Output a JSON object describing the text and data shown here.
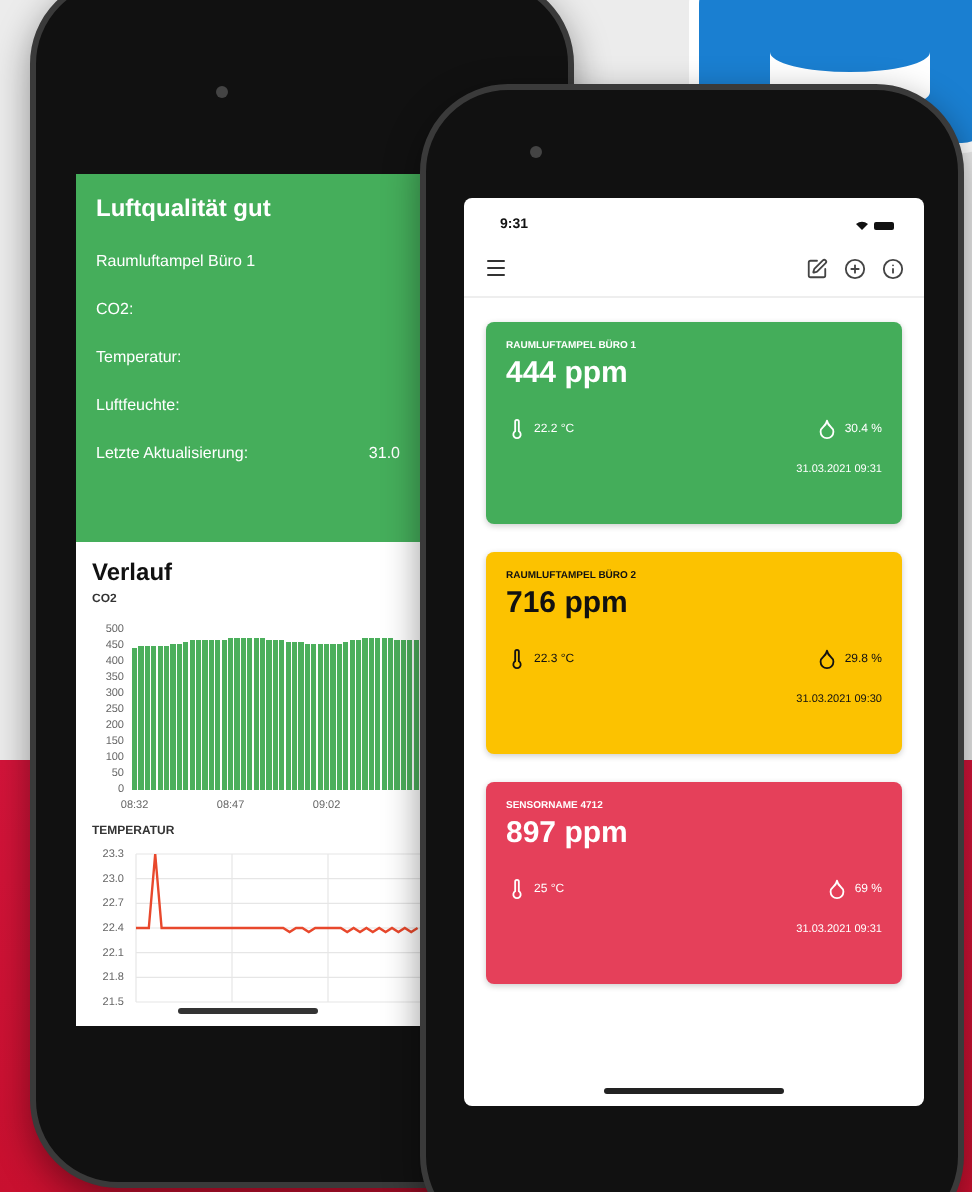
{
  "back_phone": {
    "header": {
      "title": "Luftqualität gut",
      "sensor": "Raumluftampel Büro 1",
      "fields": [
        {
          "label": "CO2:"
        },
        {
          "label": "Temperatur:"
        },
        {
          "label": "Luftfeuchte:"
        },
        {
          "label": "Letzte Aktualisierung:",
          "value": "31.0"
        }
      ]
    },
    "history": {
      "title": "Verlauf",
      "charts": [
        {
          "chart_data": {
            "type": "bar",
            "title": "CO2",
            "ylim": [
              0,
              500
            ],
            "yticks": [
              500,
              450,
              400,
              350,
              300,
              250,
              200,
              150,
              100,
              50,
              0
            ],
            "categories": [
              "08:32",
              null,
              null,
              null,
              null,
              null,
              null,
              null,
              null,
              null,
              null,
              null,
              null,
              null,
              null,
              "08:47",
              null,
              null,
              null,
              null,
              null,
              null,
              null,
              null,
              null,
              null,
              null,
              null,
              null,
              null,
              "09:02",
              null,
              null,
              null,
              null,
              null,
              null,
              null,
              null,
              null,
              null,
              null,
              null,
              null,
              null
            ],
            "series": [
              {
                "color": "#4caf5c",
                "values": [
                  445,
                  447,
                  448,
                  449,
                  450,
                  452,
                  454,
                  458,
                  465,
                  468,
                  468,
                  468,
                  468,
                  469,
                  470,
                  472,
                  475,
                  476,
                  476,
                  475,
                  472,
                  470,
                  468,
                  466,
                  464,
                  462,
                  460,
                  459,
                  458,
                  456,
                  455,
                  455,
                  458,
                  462,
                  466,
                  470,
                  472,
                  474,
                  474,
                  473,
                  472,
                  470,
                  468,
                  467,
                  466
                ]
              }
            ]
          }
        },
        {
          "chart_data": {
            "type": "line",
            "title": "TEMPERATUR",
            "grid": true,
            "ylim": [
              21.5,
              23.3
            ],
            "yticks": [
              23.3,
              {
                "value": 23,
                "label": "23.0"
              },
              22.7,
              22.4,
              22.1,
              21.8,
              21.5
            ],
            "series": [
              {
                "color": "#e8482c",
                "values": [
                  22.4,
                  22.4,
                  22.4,
                  23.3,
                  22.4,
                  22.4,
                  22.4,
                  22.4,
                  22.4,
                  22.4,
                  22.4,
                  22.4,
                  22.4,
                  22.4,
                  22.4,
                  22.4,
                  22.4,
                  22.4,
                  22.4,
                  22.4,
                  22.4,
                  22.4,
                  22.4,
                  22.4,
                  22.35,
                  22.4,
                  22.4,
                  22.35,
                  22.4,
                  22.4,
                  22.4,
                  22.4,
                  22.4,
                  22.35,
                  22.4,
                  22.35,
                  22.4,
                  22.35,
                  22.4,
                  22.35,
                  22.4,
                  22.35,
                  22.4,
                  22.35,
                  22.4
                ]
              }
            ]
          }
        }
      ]
    }
  },
  "front_phone": {
    "status_bar": {
      "time": "9:31"
    },
    "sensors": [
      {
        "name": "RAUMLUFTAMPEL BÜRO 1",
        "co2": "444 ppm",
        "temperature": "22.2 °C",
        "humidity": "30.4 %",
        "updated": "31.03.2021 09:31",
        "color": "#44ad5a",
        "kind": "light"
      },
      {
        "name": "RAUMLUFTAMPEL BÜRO 2",
        "co2": "716 ppm",
        "temperature": "22.3 °C",
        "humidity": "29.8 %",
        "updated": "31.03.2021 09:30",
        "color": "#fcc200",
        "kind": "dark"
      },
      {
        "name": "SENSORNAME 4712",
        "co2": "897 ppm",
        "temperature": "25 °C",
        "humidity": "69 %",
        "updated": "31.03.2021 09:31",
        "color": "#e5405a",
        "kind": "light"
      }
    ]
  }
}
